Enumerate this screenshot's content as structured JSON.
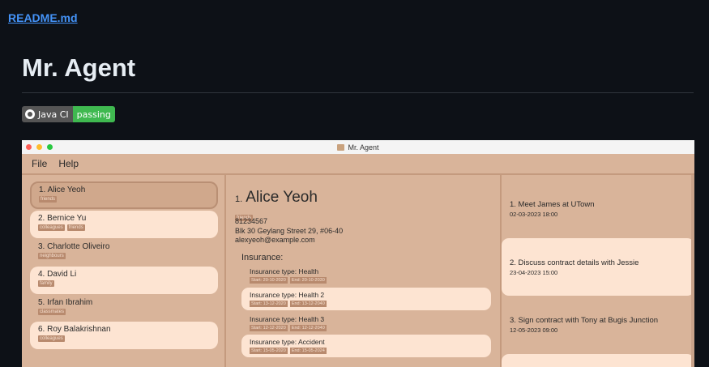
{
  "header": {
    "readme_link": "README.md",
    "title": "Mr. Agent"
  },
  "badge": {
    "label": "Java CI",
    "status": "passing",
    "status_color": "#3fb950"
  },
  "app": {
    "window_title": "Mr. Agent",
    "menu": [
      "File",
      "Help"
    ],
    "persons": [
      {
        "index": "1.",
        "name": "Alice Yeoh",
        "tags": [
          "friends"
        ]
      },
      {
        "index": "2.",
        "name": "Bernice Yu",
        "tags": [
          "colleagues",
          "friends"
        ]
      },
      {
        "index": "3.",
        "name": "Charlotte Oliveiro",
        "tags": [
          "neighbours"
        ]
      },
      {
        "index": "4.",
        "name": "David Li",
        "tags": [
          "family"
        ]
      },
      {
        "index": "5.",
        "name": "Irfan Ibrahim",
        "tags": [
          "classmates"
        ]
      },
      {
        "index": "6.",
        "name": "Roy Balakrishnan",
        "tags": [
          "colleagues"
        ]
      }
    ],
    "detail": {
      "index": "1.",
      "name": "Alice Yeoh",
      "tag": "friends",
      "phone": "81234567",
      "address": "Blk 30 Geylang Street 29, #06-40",
      "email": "alexyeoh@example.com",
      "insurance_heading": "Insurance:",
      "insurances": [
        {
          "type": "Insurance type: Health",
          "start": "Start: 20-10-2020",
          "end": "End: 20-10-2030"
        },
        {
          "type": "Insurance type: Health 2",
          "start": "Start: 13-12-2020",
          "end": "End: 13-12-2040"
        },
        {
          "type": "Insurance type: Health 3",
          "start": "Start: 12-12-2020",
          "end": "End: 12-12-2040"
        },
        {
          "type": "Insurance type: Accident",
          "start": "Start: 15-05-2020",
          "end": "End: 15-05-2024"
        }
      ]
    },
    "events": [
      {
        "title": "1. Meet James at UTown",
        "date": "02-03-2023 18:00"
      },
      {
        "title": "2. Discuss contract details with Jessie",
        "date": "23-04-2023 15:00"
      },
      {
        "title": "3. Sign contract with Tony at Bugis Junction",
        "date": "12-05-2023 09:00"
      }
    ]
  }
}
